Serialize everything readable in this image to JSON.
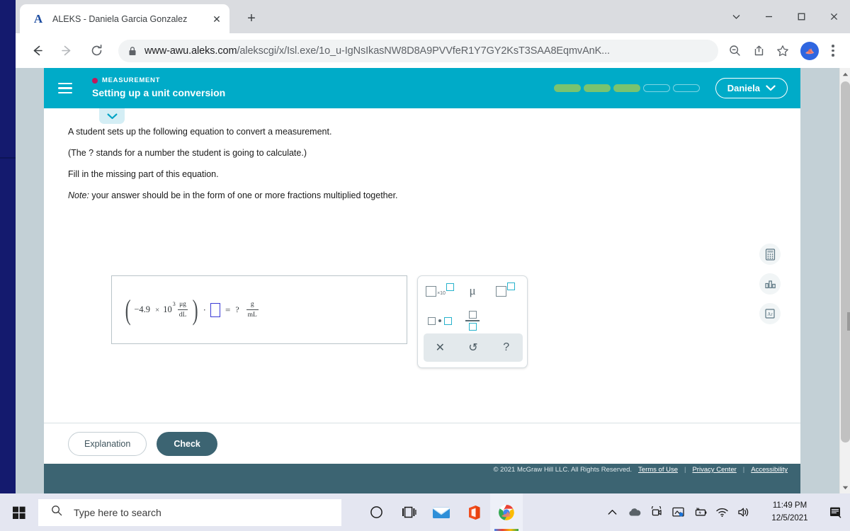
{
  "browser": {
    "tab": {
      "favicon_letter": "A",
      "title": "ALEKS - Daniela Garcia Gonzalez",
      "close_glyph": "✕",
      "new_tab_glyph": "+"
    },
    "window_controls": {
      "tab_search": "tab-search",
      "minimize": "minimize",
      "maximize": "maximize",
      "close": "close"
    },
    "url": {
      "domain": "www-awu.aleks.com",
      "path": "/alekscgi/x/Isl.exe/1o_u-IgNsIkasNW8D8A9PVVfeR1Y7GY2KsT3SAA8EqmvAnK...",
      "full": "www-awu.aleks.com/alekscgi/x/Isl.exe/1o_u-IgNsIkasNW8D8A9PVVfeR1Y7GY2KsT3SAA8EqmvAnK..."
    },
    "toolbar_icons": [
      "zoom-out-icon",
      "share-icon",
      "bookmark-star-icon",
      "profile-avatar",
      "kebab-menu-icon"
    ]
  },
  "aleks": {
    "header": {
      "menu": "hamburger-menu",
      "category": "MEASUREMENT",
      "title": "Setting up a unit conversion",
      "progress": {
        "total": 5,
        "filled": 3
      },
      "user": {
        "name": "Daniela",
        "caret": "chevron-down-icon"
      }
    },
    "collapse_tab": "chevron-down-icon",
    "question": {
      "line1": "A student sets up the following equation to convert a measurement.",
      "line2": "(The ? stands for a number the student is going to calculate.)",
      "line3": "Fill in the missing part of this equation.",
      "note_label": "Note:",
      "note_text": " your answer should be in the form of one or more fractions multiplied together."
    },
    "equation": {
      "coefficient": "−4.9",
      "times": "×",
      "base": "10",
      "exponent": "3",
      "unit_numerator": "μg",
      "unit_denominator": "dL",
      "multiply_dot": "·",
      "answer_box_value": "",
      "equals": "=",
      "question_mark": "?",
      "result_numerator": "g",
      "result_denominator": "mL"
    },
    "palette": {
      "buttons": [
        {
          "name": "scientific-notation",
          "label": "×10"
        },
        {
          "name": "micro-symbol",
          "label": "μ"
        },
        {
          "name": "superscript",
          "label": ""
        },
        {
          "name": "multiplication",
          "label": ""
        },
        {
          "name": "fraction",
          "label": ""
        }
      ],
      "actions": [
        {
          "name": "clear",
          "glyph": "✕"
        },
        {
          "name": "undo",
          "glyph": "↺"
        },
        {
          "name": "help",
          "glyph": "?"
        }
      ]
    },
    "tools": [
      {
        "name": "calculator-icon"
      },
      {
        "name": "data-chart-icon"
      },
      {
        "name": "periodic-table-icon",
        "label": "Ar"
      }
    ],
    "actions": {
      "explanation": "Explanation",
      "check": "Check"
    },
    "footer": {
      "copyright": "© 2021 McGraw Hill LLC. All Rights Reserved.",
      "links": [
        "Terms of Use",
        "Privacy Center",
        "Accessibility"
      ],
      "separator": "|"
    }
  },
  "taskbar": {
    "start": "windows-start-icon",
    "search_placeholder": "Type here to search",
    "cortana": "cortana-icon",
    "task_view": "task-view-icon",
    "apps": [
      "mail-icon",
      "office-icon",
      "chrome-icon"
    ],
    "tray": [
      "show-hidden-icons-chevron",
      "onedrive-cloud-icon",
      "meet-camera-icon",
      "display-icon",
      "battery-icon",
      "wifi-icon",
      "volume-icon"
    ],
    "time": "11:49 PM",
    "date": "12/5/2021",
    "notifications": "notifications-icon"
  },
  "colors": {
    "aleks_teal": "#00abc8",
    "progress_green": "#7ac36f",
    "category_dot": "#c2185b",
    "check_button": "#3c6472",
    "answer_outline": "#3b3bd6",
    "desktop": "#141a6e"
  }
}
